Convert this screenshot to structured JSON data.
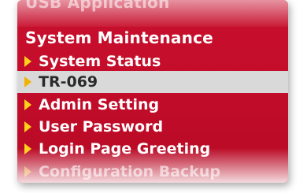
{
  "menu": {
    "prev_section_label": "USB Application",
    "section_title": "System Maintenance",
    "items": [
      {
        "label": "System Status",
        "selected": false
      },
      {
        "label": "TR-069",
        "selected": true
      },
      {
        "label": "Admin Setting",
        "selected": false
      },
      {
        "label": "User Password",
        "selected": false
      },
      {
        "label": "Login Page Greeting",
        "selected": false
      },
      {
        "label": "Configuration Backup",
        "selected": false
      }
    ]
  },
  "colors": {
    "menu_background": "#c8102e",
    "selected_background": "#d9d9d9",
    "arrow": "#ffd11a",
    "text": "#ffffff"
  },
  "icons": {
    "item_bullet": "triangle-right-icon"
  }
}
